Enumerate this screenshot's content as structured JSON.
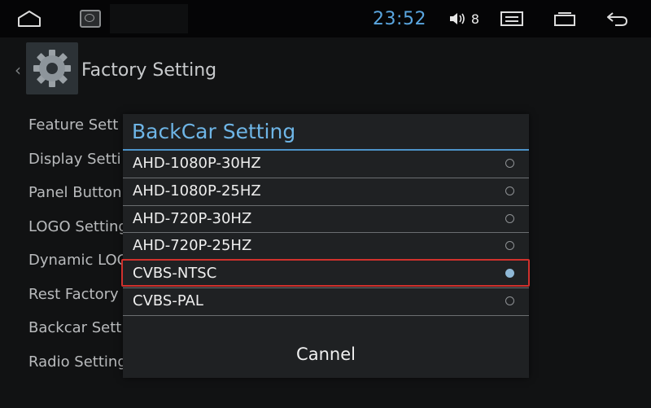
{
  "statusbar": {
    "clock": "23:52",
    "volume_level": "8",
    "icons": [
      "home-icon",
      "app-thumbnail-icon",
      "volume-icon",
      "menu-icon",
      "recent-apps-icon",
      "back-icon"
    ]
  },
  "header": {
    "title": "Factory Setting",
    "icon": "gear-icon"
  },
  "menu": {
    "items": [
      "Feature Sett",
      "Display Setti",
      "Panel Button",
      "LOGO Setting",
      "Dynamic LOG",
      "Rest Factory",
      "Backcar Sett",
      "Radio Setting"
    ]
  },
  "dialog": {
    "title": "BackCar Setting",
    "options": [
      {
        "label": "AHD-1080P-30HZ",
        "selected": false
      },
      {
        "label": "AHD-1080P-25HZ",
        "selected": false
      },
      {
        "label": "AHD-720P-30HZ",
        "selected": false
      },
      {
        "label": "AHD-720P-25HZ",
        "selected": false
      },
      {
        "label": "CVBS-NTSC",
        "selected": true
      },
      {
        "label": "CVBS-PAL",
        "selected": false
      }
    ],
    "cancel_label": "Cannel"
  },
  "colors": {
    "accent": "#6eb5e6",
    "highlight_border": "#d0312d",
    "clock": "#5aa6e0"
  }
}
